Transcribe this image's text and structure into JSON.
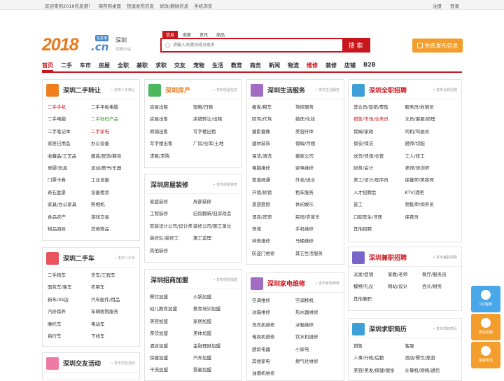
{
  "topbar": {
    "welcome": "欢迎来到2018信息港！",
    "links": [
      "保存到桌面",
      "快速发布信息",
      "修改/删除信息",
      "手机浏览"
    ],
    "login": "注册",
    "register": "登录"
  },
  "header": {
    "logo_num": "2018",
    "logo_cn": ".cn",
    "logo_badge": "信息港",
    "city": "深圳",
    "switch_city": "切换分站",
    "search_tabs": [
      "信息",
      "商家",
      "资讯",
      "商品"
    ],
    "search_placeholder": "请输入关键词或分类名",
    "search_button": "搜 索",
    "publish_button": "免费发布信息"
  },
  "nav": [
    "首页",
    "二手",
    "车市",
    "房屋",
    "全职",
    "兼职",
    "求职",
    "交友",
    "宠物",
    "生活",
    "教育",
    "商务",
    "新闻",
    "物流",
    "维修",
    "装修",
    "店铺",
    "B2B"
  ],
  "panels": {
    "ershou": {
      "title": "深圳二手转让",
      "more": "• 发布二手转让",
      "items": [
        "二手手机",
        "二手平板电脑",
        "二手电脑",
        "二手数码产品",
        "二手笔记本",
        "二手家电",
        "家居日用品",
        "办公设备",
        "收藏品/工艺品",
        "服装/配饰/鞋包",
        "母婴/玩具",
        "运动/图书/乐器",
        "门票卡券",
        "工业设备",
        "奇石盆景",
        "设备租赁",
        "家具/办公家具",
        "照相机",
        "食品农产",
        "游戏交易",
        "物品回收",
        "其他物品"
      ]
    },
    "car": {
      "title": "深圳二手车",
      "more": "• 发布二手车",
      "items": [
        "二手轿车",
        "货车/工程车",
        "面包车/客车",
        "农用车",
        "新车/4S店",
        "汽车配件/用品",
        "汽修保养",
        "车辆收购服务",
        "摩托车",
        "电动车",
        "自行车",
        "下线车"
      ]
    },
    "jiaoyou": {
      "title": "深圳交友活动",
      "more": "• 发布交友活动"
    },
    "house": {
      "title": "深圳房产",
      "more": "• 发布房屋信息",
      "items": [
        "房屋出租",
        "短租/日租",
        "房屋出售",
        "店铺转让/出租",
        "商铺出售",
        "写字楼出租",
        "写字楼出售",
        "厂房/仓库/土地",
        "求租/求购"
      ]
    },
    "zhuangxiu": {
      "title": "深圳房屋装修",
      "more": "• 发布房屋装修",
      "items": [
        "家庭装修",
        "局部装修",
        "工程装修",
        "旧房翻新/旧房改造",
        "软装设计公司/设计师",
        "装修公司/施工单位",
        "装修队/装修工",
        "施工监理",
        "其他装修"
      ]
    },
    "jiameng": {
      "title": "深圳招商加盟",
      "more": "• 发布招商加盟",
      "items": [
        "餐饮加盟",
        "火锅加盟",
        "幼儿教育加盟",
        "教育培训加盟",
        "美容加盟",
        "家居加盟",
        "茶饮加盟",
        "美体加盟",
        "酒店加盟",
        "金融理财加盟",
        "保健加盟",
        "汽车加盟",
        "干洗加盟",
        "婴童加盟"
      ]
    },
    "life": {
      "title": "深圳生活服务",
      "more": "• 发布生活服务",
      "items": [
        "搬家/租车",
        "驾校服务",
        "陪驾/代驾",
        "婚庆/化妆",
        "摄影摄像",
        "美容纤体",
        "建材装饰",
        "保姆/月嫂",
        "保洁/清洗",
        "搬家公司",
        "电脑维修",
        "家电维修",
        "管道疏通",
        "外卖/送水",
        "开锁/修锁",
        "租车服务",
        "旅游度假",
        "休闲娱乐",
        "酒店/宾馆",
        "民宿/农家乐",
        "快递",
        "手机维修",
        "钟表维修",
        "马桶维修",
        "防盗门维修",
        "其它生活服务"
      ]
    },
    "repair": {
      "title": "深圳家电维修",
      "more": "• 发布家电维修",
      "items": [
        "空调维修",
        "空调移机",
        "冰箱维修",
        "热水器维修",
        "洗衣机维修",
        "冰箱维修",
        "电视机维修",
        "饮水机维修",
        "厨房电器",
        "小家电",
        "其他家电",
        "燃气灶维修",
        "油烟机维修"
      ]
    },
    "fulltime": {
      "title": "深圳全职招聘",
      "more": "• 发布全职招聘",
      "items": [
        "营业员/促销/零售",
        "服务员/收银员",
        "销售/市场/业务员",
        "文员/客服/助理",
        "保姆/家政",
        "司机/驾驶员",
        "保安/保洁",
        "厨师/切配",
        "送货/快递/仓管",
        "工人/技工",
        "财务/会计",
        "老师/培训师",
        "美工/设计/程序员",
        "保健师/美容师",
        "人才招聘会",
        "KTV/酒吧",
        "普工",
        "销售师/饲养员",
        "口腔医生/牙医",
        "保育员",
        "其他招聘"
      ]
    },
    "parttime": {
      "title": "深圳兼职招聘",
      "more": "• 发布兼职招聘",
      "items": [
        "派发/促销",
        "家教/老师",
        "餐厅/服务员",
        "模特/礼仪",
        "网站/设计",
        "会计/财务",
        "其他兼职"
      ]
    },
    "resume": {
      "title": "深圳求职简历",
      "more": "• 发布求职简历",
      "items": [
        "销售",
        "客服",
        "人事/行政/后勤",
        "酒店/餐饮/旅游",
        "美容/美发/保健/健身",
        "计算机/网络/通信"
      ]
    }
  },
  "side": [
    "QQ客服",
    "微信客服",
    "客服电话"
  ],
  "colors": {
    "brand_red": "#c9161d",
    "orange": "#e57c1f",
    "blue": "#4a8ac8",
    "green": "#3a9d2a"
  }
}
